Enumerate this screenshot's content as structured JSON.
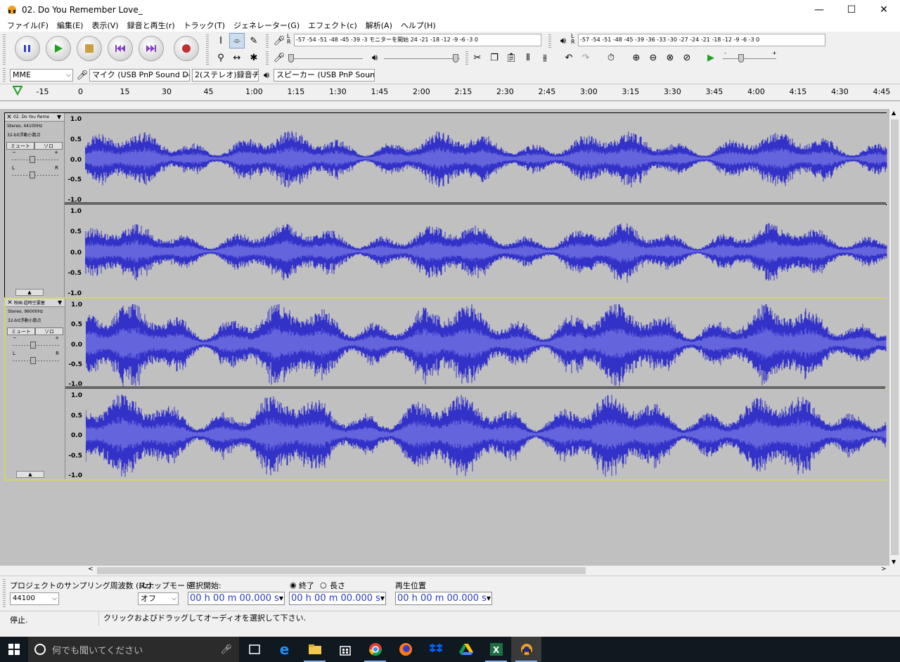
{
  "window": {
    "title": "02. Do You Remember Love_",
    "minimize": "—",
    "maximize": "☐",
    "close": "✕"
  },
  "menu": [
    "ファイル(F)",
    "編集(E)",
    "表示(V)",
    "録音と再生(r)",
    "トラック(T)",
    "ジェネレーター(G)",
    "エフェクト(c)",
    "解析(A)",
    "ヘルプ(H)"
  ],
  "meters": {
    "record_scale": "-57 -54 -51 -48 -45  -39 -3 モニターを開始 24 -21 -18  -12 -9  -6  -3  0",
    "play_scale": "-57 -54 -51 -48 -45  -39 -36 -33 -30 -27 -24 -21 -18  -12 -9  -6  -3  0",
    "L": "L",
    "R": "R",
    "minus": "-",
    "plus": "+"
  },
  "device": {
    "host": "MME",
    "input": "マイク (USB PnP Sound Devi",
    "channels": "2(ステレオ)録音チ",
    "output": "スピーカー (USB PnP Sound D"
  },
  "ruler": [
    "-15",
    "0",
    "15",
    "30",
    "45",
    "1:00",
    "1:15",
    "1:30",
    "1:45",
    "2:00",
    "2:15",
    "2:30",
    "2:45",
    "3:00",
    "3:15",
    "3:30",
    "3:45",
    "4:00",
    "4:15",
    "4:30",
    "4:45"
  ],
  "tracks": [
    {
      "name": "02. Do You Reme",
      "rate": "Stereo, 44100Hz",
      "format": "32-bit浮動小数点",
      "mute": "ミュート",
      "solo": "ソロ",
      "gain_minus": "−",
      "gain_plus": "+",
      "pan_l": "L",
      "pan_r": "R",
      "collapse": "▲"
    },
    {
      "name": "映画 超時空要塞",
      "rate": "Stereo, 96000Hz",
      "format": "32-bit浮動小数点",
      "mute": "ミュート",
      "solo": "ソロ",
      "gain_minus": "−",
      "gain_plus": "+",
      "pan_l": "L",
      "pan_r": "R",
      "collapse": "▲"
    }
  ],
  "vscale": [
    "1.0",
    "0.5",
    "0.0",
    "-0.5",
    "-1.0"
  ],
  "colors": {
    "wave_dark": "#3232c8",
    "wave_light": "#6464dc",
    "wave_bg": "#c0c0c0"
  },
  "selection": {
    "rate_label": "プロジェクトのサンプリング周波数 (Hz):",
    "rate_value": "44100",
    "snap_label": "スナップモード",
    "snap_value": "オフ",
    "start_label": "選択開始:",
    "end_label": "終了",
    "length_label": "長さ",
    "pos_label": "再生位置",
    "time_zero": "00 h 00 m 00.000 s"
  },
  "status": {
    "state": "停止.",
    "hint": "クリックおよびドラッグしてオーディオを選択して下さい."
  },
  "taskbar": {
    "search": "何でも聞いてください"
  }
}
